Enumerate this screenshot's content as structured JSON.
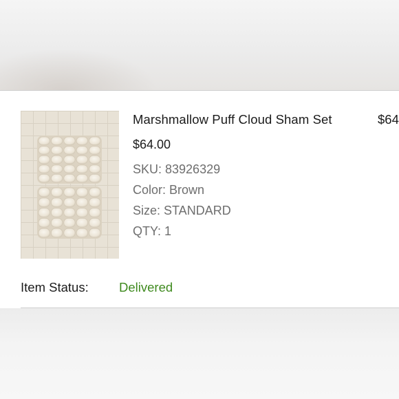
{
  "order_item": {
    "title": "Marshmallow Puff Cloud Sham Set",
    "price_column": "$64",
    "price": "$64.00",
    "sku": "SKU: 83926329",
    "color": "Color: Brown",
    "size": "Size: STANDARD",
    "qty": "QTY: 1",
    "image_icon": "product-photo-icon"
  },
  "status": {
    "label": "Item Status:",
    "value": "Delivered",
    "value_color": "#3f8a1f"
  }
}
